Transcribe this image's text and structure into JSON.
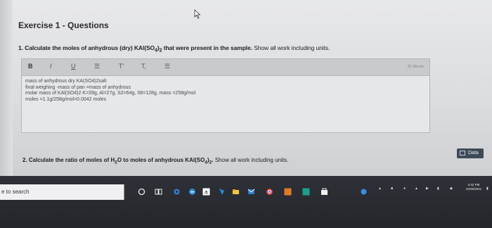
{
  "exercise_title": "Exercise 1 - Questions",
  "question1": {
    "prefix": "1. Calculate the moles of anhydrous (dry) KAl(SO",
    "sub": "4",
    "suffix": ")",
    "sub2": "2",
    "rest": " that were present in the sample. ",
    "instruction": "Show all work including units."
  },
  "toolbar": {
    "bold": "B",
    "italic": "I",
    "underline": "U",
    "list": "☰",
    "superscript": "T'",
    "subscript": "T,",
    "numbered": "☰"
  },
  "word_count": "25 Words",
  "answer_lines": [
    "mass of anhydrous dry KA(SO4)2salt",
    "final weighing -mass of pan =mass of anhydrous",
    "molar mass of KAl(SO4)2 K=39g, Al=27g, S2=64g, 08=128g, mass =258g/mol",
    "moles =1.1g/258g/mol=0.0042 moles"
  ],
  "question2": {
    "prefix": "2. Calculate the ratio of moles of H",
    "sub": "2",
    "mid": "O to moles of anhydrous KAl(SO",
    "sub2": "4",
    "close": ")",
    "sub3": "2",
    "end": ". ",
    "instruction": "Show all work including units."
  },
  "data_button": "Data",
  "taskbar": {
    "search_text": "e to search",
    "time": "3:42 PM",
    "date": "10/25/2021"
  }
}
